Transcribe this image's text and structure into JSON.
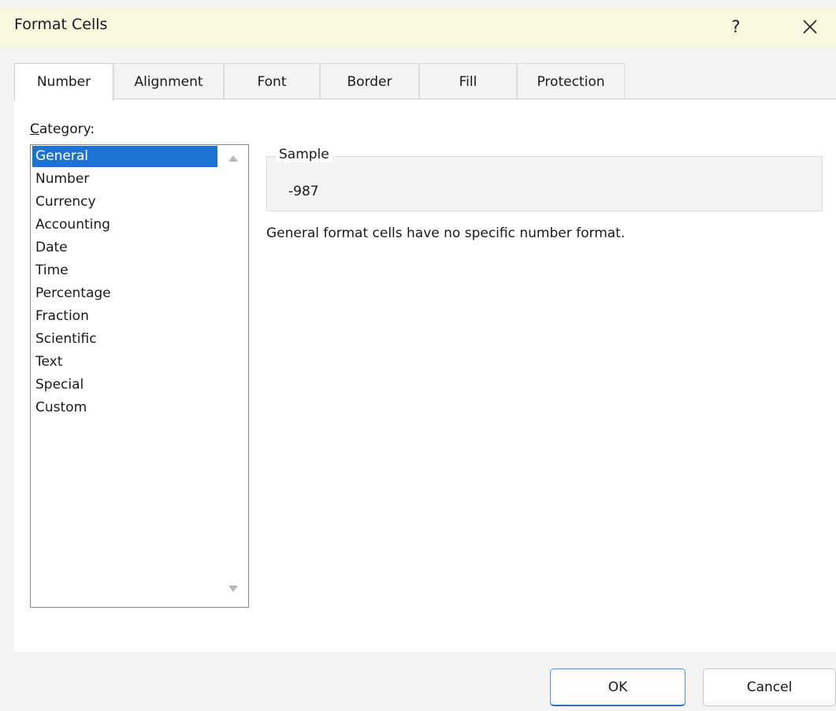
{
  "window": {
    "title": "Format Cells",
    "help_label": "?",
    "close_icon": "close-icon"
  },
  "tabs": [
    {
      "label": "Number",
      "active": true
    },
    {
      "label": "Alignment",
      "active": false
    },
    {
      "label": "Font",
      "active": false
    },
    {
      "label": "Border",
      "active": false
    },
    {
      "label": "Fill",
      "active": false
    },
    {
      "label": "Protection",
      "active": false
    }
  ],
  "category": {
    "label_first": "C",
    "label_rest": "ategory:",
    "items": [
      "General",
      "Number",
      "Currency",
      "Accounting",
      "Date",
      "Time",
      "Percentage",
      "Fraction",
      "Scientific",
      "Text",
      "Special",
      "Custom"
    ],
    "selected": "General"
  },
  "sample": {
    "legend": "Sample",
    "value": "-987"
  },
  "description": "General format cells have no specific number format.",
  "buttons": {
    "ok": "OK",
    "cancel": "Cancel"
  },
  "colors": {
    "selection": "#1e73d2",
    "titlebar": "#f8f7df"
  }
}
